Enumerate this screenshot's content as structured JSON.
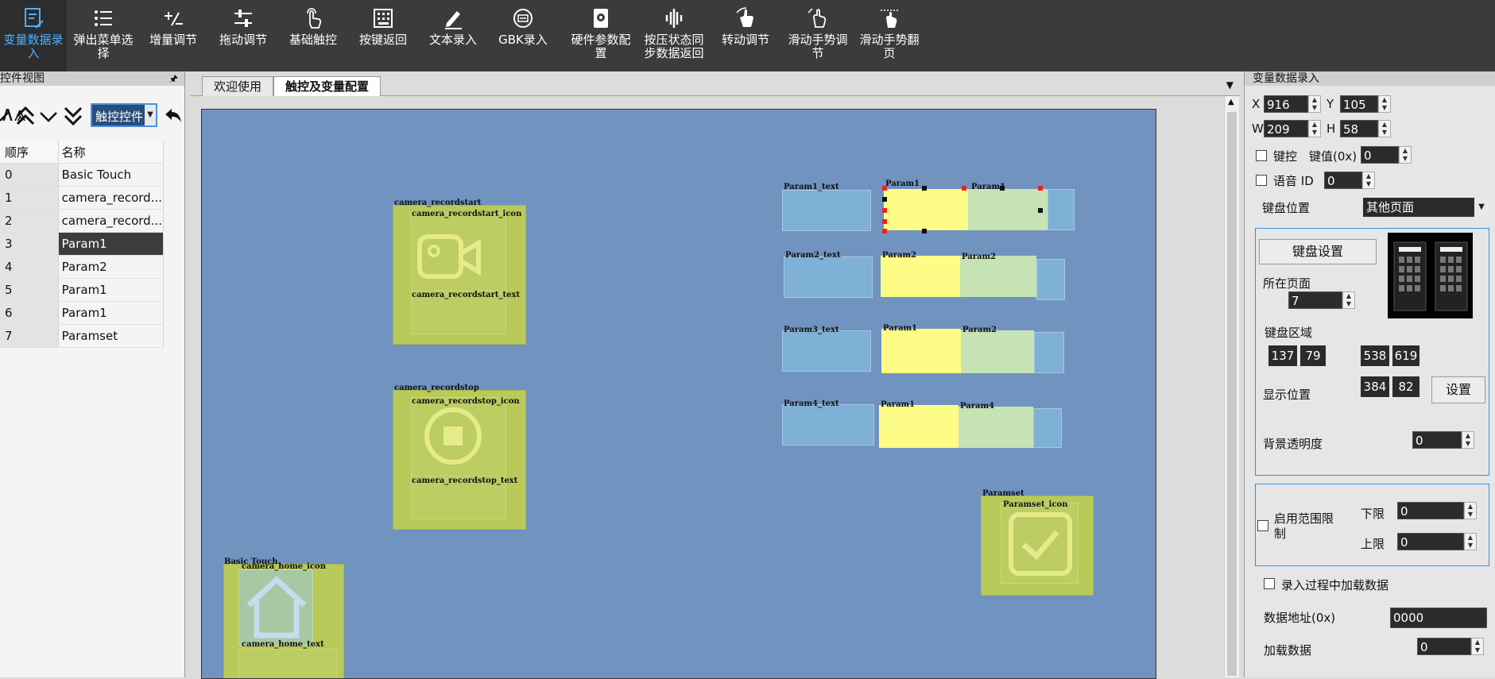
{
  "toolbar": {
    "items": [
      {
        "label": "变量数据录入",
        "icon": "document-edit-icon",
        "active": true
      },
      {
        "label": "弹出菜单选择",
        "icon": "list-icon"
      },
      {
        "label": "增量调节",
        "icon": "plus-minus-icon"
      },
      {
        "label": "拖动调节",
        "icon": "slider-icon"
      },
      {
        "label": "基础触控",
        "icon": "touch-icon"
      },
      {
        "label": "按键返回",
        "icon": "keypad-icon"
      },
      {
        "label": "文本录入",
        "icon": "pencil-icon"
      },
      {
        "label": "GBK录入",
        "icon": "gbk-icon"
      },
      {
        "label": "硬件参数配置",
        "icon": "hardware-icon"
      },
      {
        "label": "按压状态同步数据返回",
        "icon": "wave-icon"
      },
      {
        "label": "转动调节",
        "icon": "rotate-hand-icon"
      },
      {
        "label": "滑动手势调节",
        "icon": "swipe-icon"
      },
      {
        "label": "滑动手势翻页",
        "icon": "swipe-page-icon"
      }
    ]
  },
  "left_panel": {
    "title": "控件视图",
    "selector_value": "触控控件",
    "columns": [
      "顺序",
      "名称"
    ],
    "rows": [
      {
        "index": "0",
        "name": "Basic Touch"
      },
      {
        "index": "1",
        "name": "camera_record..."
      },
      {
        "index": "2",
        "name": "camera_record..."
      },
      {
        "index": "3",
        "name": "Param1",
        "selected": true
      },
      {
        "index": "4",
        "name": "Param2"
      },
      {
        "index": "5",
        "name": "Param1"
      },
      {
        "index": "6",
        "name": "Param1"
      },
      {
        "index": "7",
        "name": "Paramset"
      }
    ]
  },
  "tabs": [
    {
      "label": "欢迎使用"
    },
    {
      "label": "触控及变量配置",
      "active": true
    }
  ],
  "canvas": {
    "labels": {
      "record_start": "camera_recordstart",
      "record_start_icon": "camera_recordstart_icon",
      "record_start_text": "camera_recordstart_text",
      "record_stop": "camera_recordstop",
      "record_stop_icon": "camera_recordstop_icon",
      "record_stop_text": "camera_recordstop_text",
      "basic_touch": "Basic Touch",
      "home_icon": "camera_home_icon",
      "home_text": "camera_home_text",
      "param1_text": "Param1_text",
      "param2_text": "Param2_text",
      "param3_text": "Param3_text",
      "param4_text": "Param4_text",
      "r1a": "Param1",
      "r1b": "Param1",
      "r2a": "Param2",
      "r2b": "Param2",
      "r3a": "Param1",
      "r3b": "Param2",
      "r4a": "Param1",
      "r4b": "Param4",
      "paramset": "Paramset",
      "paramset_icon": "Paramset_icon"
    }
  },
  "right_panel": {
    "title": "变量数据录入",
    "x_label": "X",
    "x": "916",
    "y_label": "Y",
    "y": "105",
    "w_label": "W",
    "w": "209",
    "h_label": "H",
    "h": "58",
    "key_control_label": "键控",
    "key_value_label": "键值(0x)",
    "key_value": "0",
    "voice_id_label": "语音 ID",
    "voice_id": "0",
    "keyboard_pos_label": "键盘位置",
    "keyboard_pos_value": "其他页面",
    "keyboard_settings_btn": "键盘设置",
    "page_label": "所在页面",
    "page_value": "7",
    "keyboard_area_label": "键盘区域",
    "area_x1": "137",
    "area_y1": "79",
    "area_x2": "538",
    "area_y2": "619",
    "display_pos_label": "显示位置",
    "display_x": "384",
    "display_y": "82",
    "set_btn": "设置",
    "bg_opacity_label": "背景透明度",
    "bg_opacity": "0",
    "range_enable_label": "启用范围限制",
    "lower_label": "下限",
    "lower": "0",
    "upper_label": "上限",
    "upper": "0",
    "load_during_input_label": "录入过程中加载数据",
    "data_addr_label": "数据地址(0x)",
    "data_addr": "0000",
    "load_data_label": "加载数据",
    "load_data": "0"
  }
}
